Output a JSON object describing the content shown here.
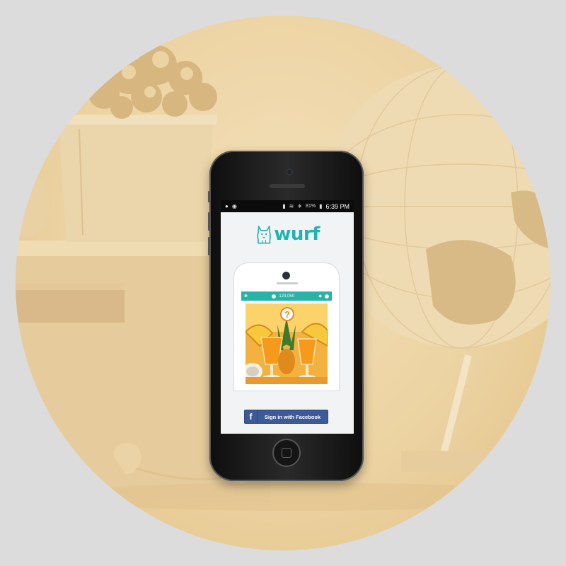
{
  "status_bar": {
    "left_icons": [
      "location-pin-icon",
      "pinterest-icon"
    ],
    "right_icons": [
      "sim-icon",
      "wifi-icon",
      "airplane-icon"
    ],
    "battery_percent": "81%",
    "time": "6:39 PM"
  },
  "app": {
    "logo_text": "wurf",
    "logo_icon": "cat-icon",
    "brand_color": "#1fb4b2"
  },
  "preview": {
    "header_left_icon": "gear-icon",
    "header_center_icon": "cat-icon",
    "header_score": "123,050",
    "header_right_icons": [
      "tag-icon",
      "chat-icon"
    ],
    "header_color": "#27b3a5",
    "question_badge": "?",
    "photo_subject": "pineapple-cocktails-image"
  },
  "signin": {
    "facebook_glyph": "f",
    "facebook_label": "Sign in with Facebook",
    "button_color": "#3d5a98"
  }
}
